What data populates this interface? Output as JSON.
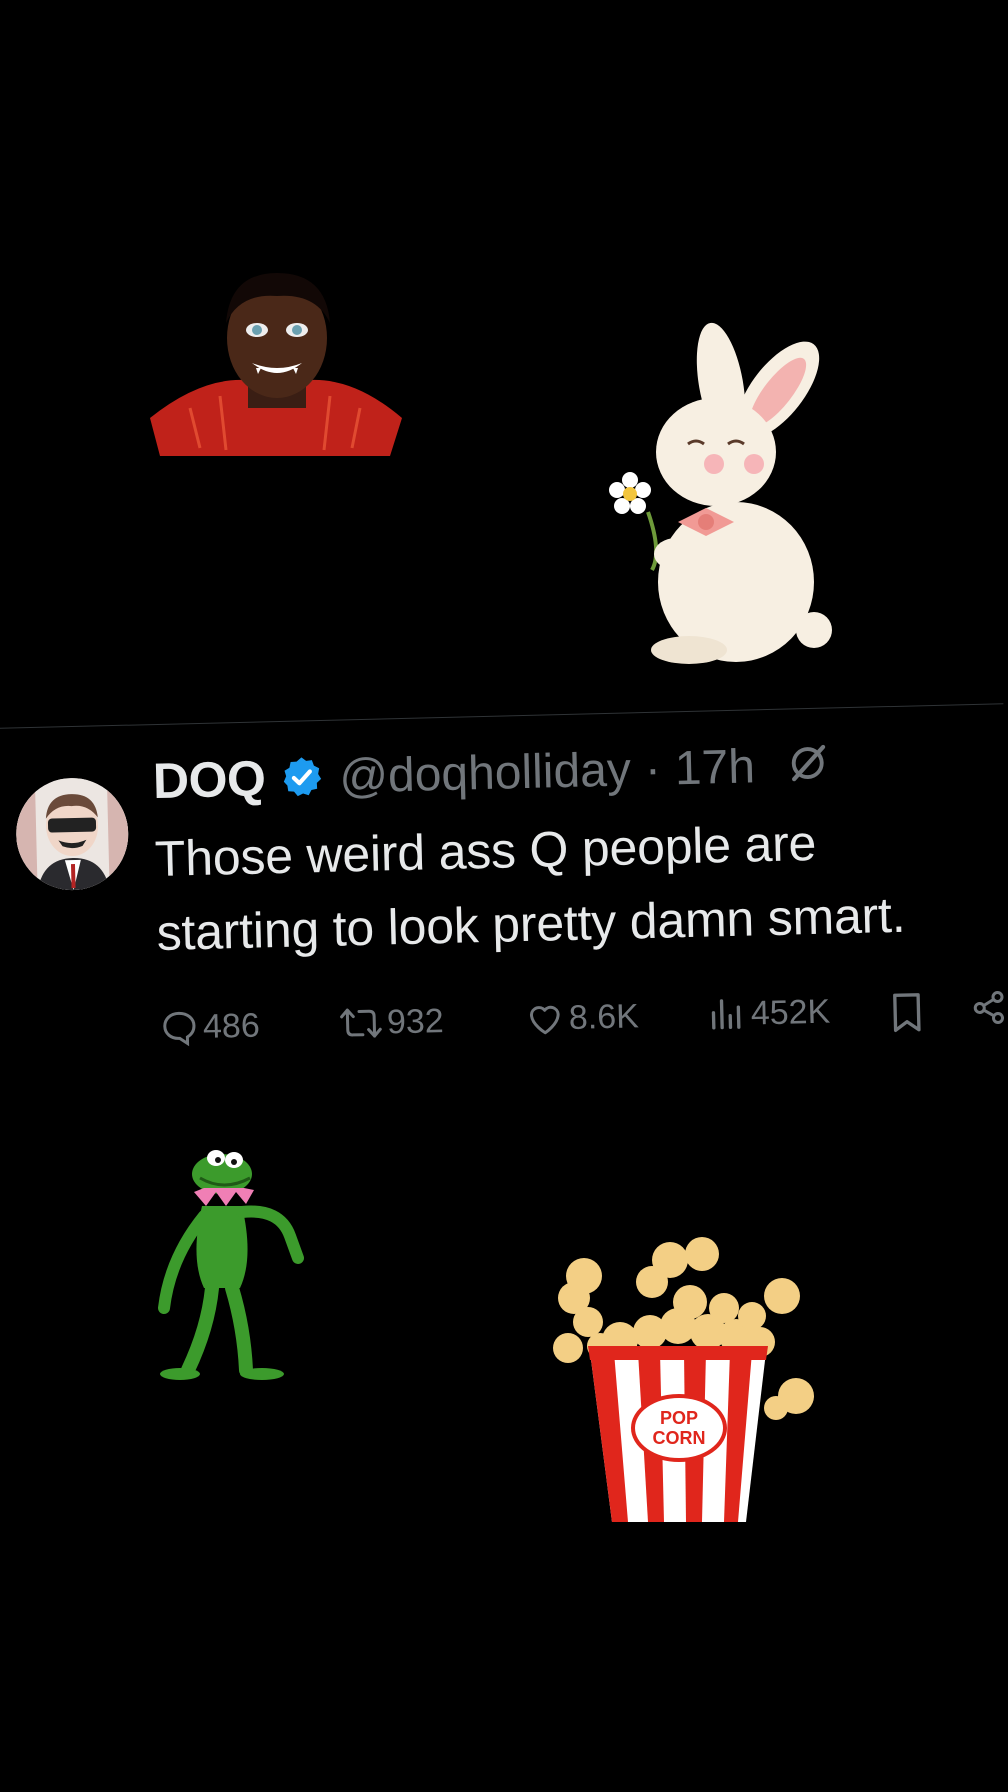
{
  "tweet": {
    "display_name": "DOQ",
    "handle": "@doqholliday",
    "separator": "·",
    "time": "17h",
    "text": "Those weird ass Q people are starting to look pretty damn smart.",
    "replies": "486",
    "reposts": "932",
    "likes": "8.6K",
    "views": "452K"
  },
  "popcorn": {
    "label_line1": "POP",
    "label_line2": "CORN"
  },
  "colors": {
    "background": "#000000",
    "text_primary": "#e7e9ea",
    "text_secondary": "#71767b",
    "verified_blue": "#1d9bf0",
    "popcorn_red": "#e0261c"
  }
}
